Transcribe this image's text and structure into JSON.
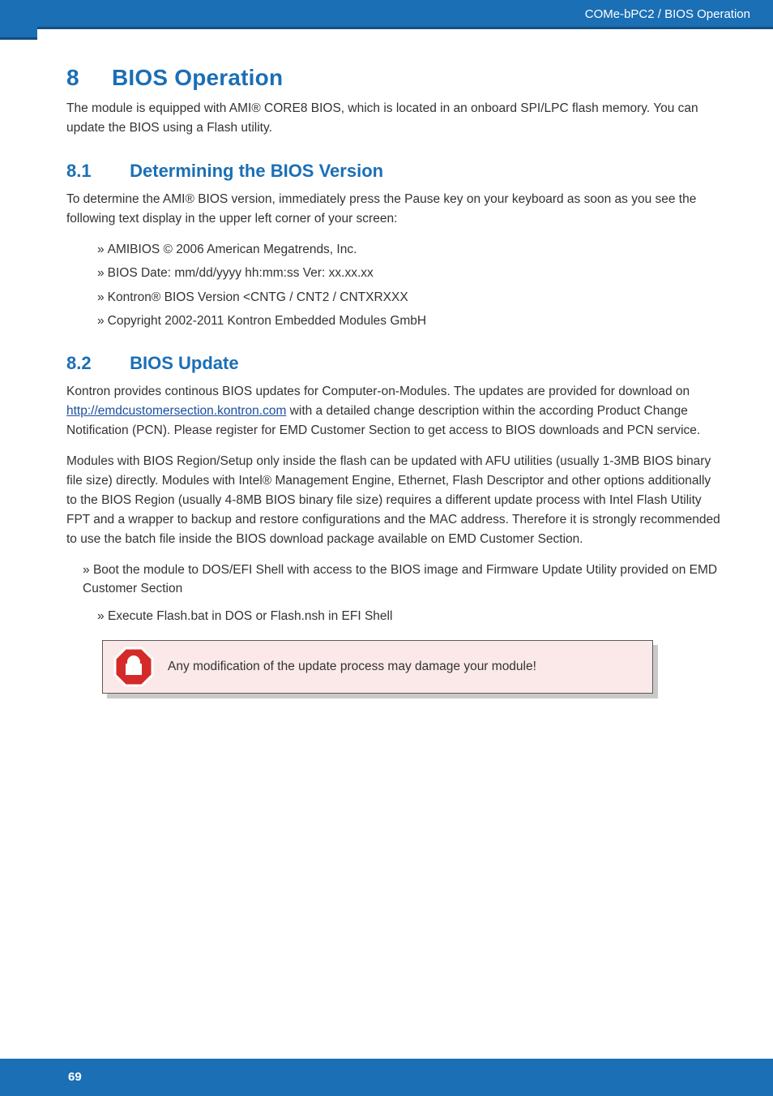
{
  "header": {
    "breadcrumb": "COMe-bPC2 / BIOS Operation"
  },
  "section": {
    "number": "8",
    "title": "BIOS Operation",
    "intro": "The module is equipped with AMI® CORE8 BIOS, which is located in an onboard SPI/LPC flash memory. You can update the BIOS using a Flash utility."
  },
  "s81": {
    "number": "8.1",
    "title": "Determining the BIOS Version",
    "para": "To determine the AMI® BIOS version, immediately press the Pause key on your keyboard as soon as you see the following text display in the upper left corner of your screen:",
    "items": [
      "AMIBIOS © 2006 American Megatrends, Inc.",
      "BIOS Date: mm/dd/yyyy hh:mm:ss Ver: xx.xx.xx",
      "Kontron® BIOS Version <CNTG / CNT2 / CNTXRXXX",
      "Copyright 2002-2011 Kontron Embedded Modules GmbH"
    ]
  },
  "s82": {
    "number": "8.2",
    "title": "BIOS Update",
    "para1_pre": "Kontron provides continous BIOS updates for Computer-on-Modules. The updates are provided for download on ",
    "link_text": "http://emdcustomersection.kontron.com",
    "para1_post": " with a detailed change description within the according Product Change Notification (PCN). Please register for EMD Customer Section to get access to BIOS downloads and PCN service.",
    "para2": "Modules with BIOS Region/Setup only inside the flash can be updated with AFU utilities (usually 1-3MB BIOS binary file size) directly. Modules with Intel® Management Engine, Ethernet, Flash Descriptor and other options additionally to the BIOS Region (usually 4-8MB BIOS binary file size) requires a different update process with Intel Flash Utility FPT and a wrapper to backup and restore configurations and the MAC address. Therefore it is strongly recommended to use the batch file inside the BIOS download package available on EMD Customer Section.",
    "steps": [
      "Boot the module to DOS/EFI Shell with access to the BIOS image and Firmware Update Utility provided on EMD Customer Section",
      "Execute Flash.bat in DOS or Flash.nsh in EFI Shell"
    ]
  },
  "callout": {
    "icon_name": "stop-icon",
    "text": "Any modification of the update process may damage your module!"
  },
  "footer": {
    "page_number": "69"
  }
}
